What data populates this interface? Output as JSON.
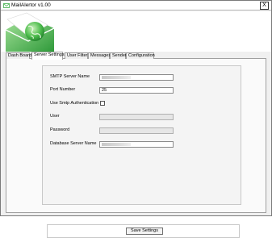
{
  "window": {
    "title": "MailAlertor v1.00",
    "close_glyph": "X"
  },
  "tabs": [
    {
      "label": "Dash Board",
      "active": false
    },
    {
      "label": "Server Settings",
      "active": true
    },
    {
      "label": "User Filter",
      "active": false
    },
    {
      "label": "Messages",
      "active": false
    },
    {
      "label": "Sender",
      "active": false
    },
    {
      "label": "Configuration",
      "active": false
    }
  ],
  "form": {
    "smtp_server_name_label": "SMTP Server Name",
    "smtp_server_name_value": "",
    "port_number_label": "Port Number",
    "port_number_value": "25",
    "use_smtp_auth_label": "Use Smtp Authentication",
    "use_smtp_auth_checked": false,
    "user_label": "User",
    "user_value": "",
    "password_label": "Password",
    "password_value": "",
    "database_server_name_label": "Database Server Name",
    "database_server_name_value": ""
  },
  "save_button_label": "Save Settings",
  "icons": {
    "title": "mail-envelope-icon",
    "logo": "envelope-globe-logo",
    "close": "close-icon"
  },
  "colors": {
    "logo_green": "#3fae49",
    "logo_green_light": "#8fd68a",
    "envelope_white": "#ffffff"
  }
}
